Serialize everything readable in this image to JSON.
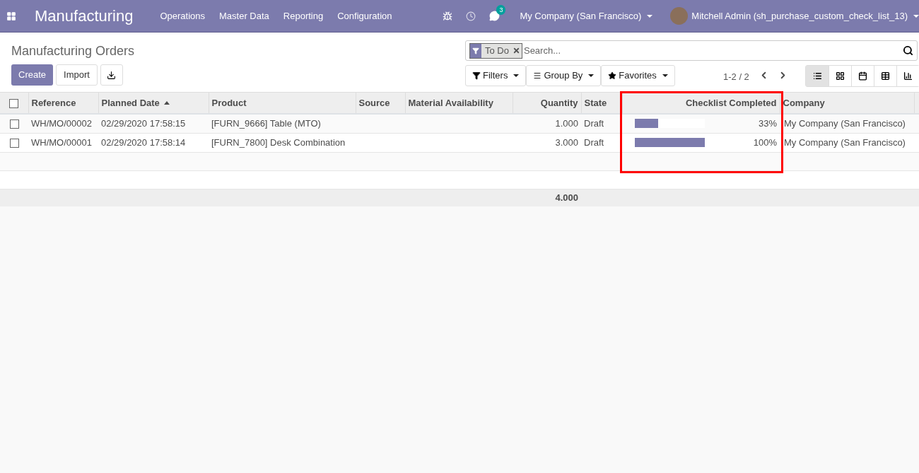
{
  "navbar": {
    "app_title": "Manufacturing",
    "menus": [
      "Operations",
      "Master Data",
      "Reporting",
      "Configuration"
    ],
    "message_count": "3",
    "company": "My Company (San Francisco)",
    "user": "Mitchell Admin (sh_purchase_custom_check_list_13)"
  },
  "control_panel": {
    "title": "Manufacturing Orders",
    "buttons": [
      "Create",
      "Import"
    ],
    "facet": "To Do",
    "search": {
      "placeholder": "Search..."
    },
    "search_menus": [
      "Filters",
      "Group By",
      "Favorites"
    ],
    "pager": "1-2 / 2",
    "views": [
      {
        "kind": "list",
        "selected": true
      },
      {
        "kind": "kanban",
        "selected": false
      },
      {
        "kind": "calendar",
        "selected": false
      },
      {
        "kind": "pivot",
        "selected": false
      },
      {
        "kind": "graph",
        "selected": false
      }
    ]
  },
  "table": {
    "all_checked": false,
    "columns": [
      {
        "label": "Reference",
        "sorted": false
      },
      {
        "label": "Planned Date",
        "sorted": true
      },
      {
        "label": "Product",
        "sorted": false
      },
      {
        "label": "Source",
        "sorted": false
      },
      {
        "label": "Material Availability",
        "sorted": false
      },
      {
        "label": "Quantity",
        "sorted": false
      },
      {
        "label": "State",
        "sorted": false
      },
      {
        "label": "Checklist Completed",
        "sorted": false
      },
      {
        "label": "Company",
        "sorted": false
      }
    ],
    "rows": [
      {
        "checked": false,
        "reference": "WH/MO/00002",
        "planned_date": "02/29/2020 17:58:15",
        "product": "[FURN_9666] Table (MTO)",
        "quantity": "1.000",
        "state": "Draft",
        "level": 0.33,
        "percent": "33%",
        "company": "My Company (San Francisco)"
      },
      {
        "checked": false,
        "reference": "WH/MO/00001",
        "planned_date": "02/29/2020 17:58:14",
        "product": "[FURN_7800] Desk Combination",
        "quantity": "3.000",
        "state": "Draft",
        "level": 1,
        "percent": "100%",
        "company": "My Company (San Francisco)"
      }
    ],
    "total_quantity": "4.000"
  }
}
